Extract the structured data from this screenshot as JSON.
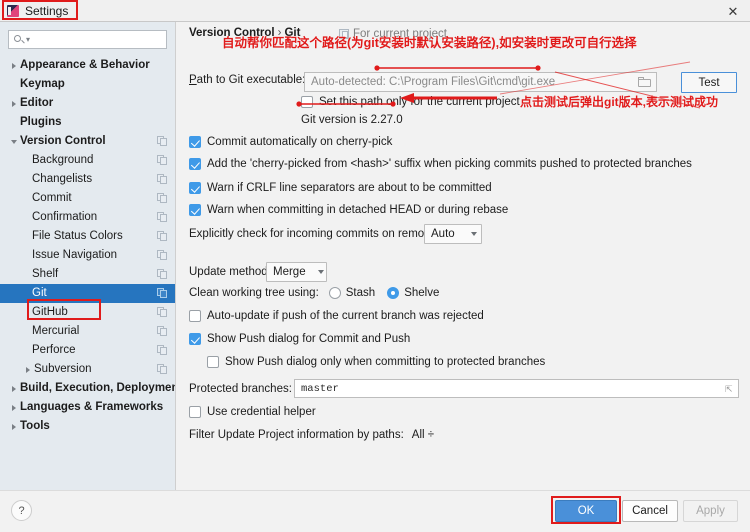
{
  "window": {
    "title": "Settings",
    "app_icon": "intellij-icon",
    "close_label": "✕"
  },
  "sidebar": {
    "search": {
      "value": "",
      "placeholder": ""
    },
    "items": [
      {
        "label": "Appearance & Behavior",
        "bold": true,
        "indent": 8,
        "arrow": "closed",
        "project_icon": false,
        "selected": false
      },
      {
        "label": "Keymap",
        "bold": true,
        "indent": 20,
        "arrow": "none",
        "project_icon": false,
        "selected": false
      },
      {
        "label": "Editor",
        "bold": true,
        "indent": 8,
        "arrow": "closed",
        "project_icon": false,
        "selected": false
      },
      {
        "label": "Plugins",
        "bold": true,
        "indent": 20,
        "arrow": "none",
        "project_icon": false,
        "selected": false
      },
      {
        "label": "Version Control",
        "bold": true,
        "indent": 8,
        "arrow": "open",
        "project_icon": true,
        "selected": false
      },
      {
        "label": "Background",
        "bold": false,
        "indent": 32,
        "arrow": "none",
        "project_icon": true,
        "selected": false
      },
      {
        "label": "Changelists",
        "bold": false,
        "indent": 32,
        "arrow": "none",
        "project_icon": true,
        "selected": false
      },
      {
        "label": "Commit",
        "bold": false,
        "indent": 32,
        "arrow": "none",
        "project_icon": true,
        "selected": false
      },
      {
        "label": "Confirmation",
        "bold": false,
        "indent": 32,
        "arrow": "none",
        "project_icon": true,
        "selected": false
      },
      {
        "label": "File Status Colors",
        "bold": false,
        "indent": 32,
        "arrow": "none",
        "project_icon": true,
        "selected": false
      },
      {
        "label": "Issue Navigation",
        "bold": false,
        "indent": 32,
        "arrow": "none",
        "project_icon": true,
        "selected": false
      },
      {
        "label": "Shelf",
        "bold": false,
        "indent": 32,
        "arrow": "none",
        "project_icon": true,
        "selected": false
      },
      {
        "label": "Git",
        "bold": false,
        "indent": 32,
        "arrow": "none",
        "project_icon": true,
        "selected": true
      },
      {
        "label": "GitHub",
        "bold": false,
        "indent": 32,
        "arrow": "none",
        "project_icon": true,
        "selected": false
      },
      {
        "label": "Mercurial",
        "bold": false,
        "indent": 32,
        "arrow": "none",
        "project_icon": true,
        "selected": false
      },
      {
        "label": "Perforce",
        "bold": false,
        "indent": 32,
        "arrow": "none",
        "project_icon": true,
        "selected": false
      },
      {
        "label": "Subversion",
        "bold": false,
        "indent": 22,
        "arrow": "closed",
        "project_icon": true,
        "selected": false
      },
      {
        "label": "Build, Execution, Deployment",
        "bold": true,
        "indent": 8,
        "arrow": "closed",
        "project_icon": false,
        "selected": false
      },
      {
        "label": "Languages & Frameworks",
        "bold": true,
        "indent": 8,
        "arrow": "closed",
        "project_icon": false,
        "selected": false
      },
      {
        "label": "Tools",
        "bold": true,
        "indent": 8,
        "arrow": "closed",
        "project_icon": false,
        "selected": false
      }
    ]
  },
  "main": {
    "breadcrumb_root": "Version Control",
    "breadcrumb_sep": "›",
    "breadcrumb_leaf": "Git",
    "for_current_project": "For current project",
    "path_label_pre": "P",
    "path_label_rest": "ath to Git executable:",
    "path_value": "Auto-detected: C:\\Program Files\\Git\\cmd\\git.exe",
    "test_button": "Test",
    "set_path_only_label": "Set this path only for the current project",
    "set_path_only_checked": false,
    "git_version": "Git version is 2.27.0",
    "checkboxes": [
      {
        "label": "Commit automatically on cherry-pick",
        "checked": true
      },
      {
        "label": "Add the 'cherry-picked from <hash>' suffix when picking commits pushed to protected branches",
        "checked": true
      },
      {
        "label": "Warn if CRLF line separators are about to be committed",
        "checked": true
      },
      {
        "label": "Warn when committing in detached HEAD or during rebase",
        "checked": true
      }
    ],
    "incoming_label": "Explicitly check for incoming commits on remotes:",
    "incoming_value": "Auto",
    "update_method_label": "Update method:",
    "update_method_value": "Merge",
    "clean_tree_label": "Clean working tree using:",
    "clean_tree_options": [
      {
        "label": "Stash",
        "selected": false
      },
      {
        "label": "Shelve",
        "selected": true
      }
    ],
    "auto_update_label": "Auto-update if push of the current branch was rejected",
    "auto_update_checked": false,
    "show_push_label": "Show Push dialog for Commit and Push",
    "show_push_checked": true,
    "show_push_protected_label": "Show Push dialog only when committing to protected branches",
    "show_push_protected_checked": false,
    "protected_branches_label": "Protected branches:",
    "protected_branches_value": "master",
    "credential_helper_label": "Use credential helper",
    "credential_helper_checked": false,
    "filter_label": "Filter Update Project information by paths:",
    "filter_value": "All ÷"
  },
  "footer": {
    "help_label": "?",
    "ok_label": "OK",
    "cancel_label": "Cancel",
    "apply_label": "Apply"
  },
  "annotations": [
    {
      "id": "anno-path",
      "text": "自动帮你匹配这个路径(为git安装时默认安装路径),如安装时更改可自行选择"
    },
    {
      "id": "anno-test",
      "text": "点击测试后弹出git版本,表示测试成功"
    }
  ],
  "colors": {
    "accent_blue": "#4a90d9",
    "selection_blue": "#2675bf",
    "annotation_red": "#e01b1b",
    "sidebar_bg": "#e4eaef",
    "panel_bg": "#f2f2f2"
  }
}
